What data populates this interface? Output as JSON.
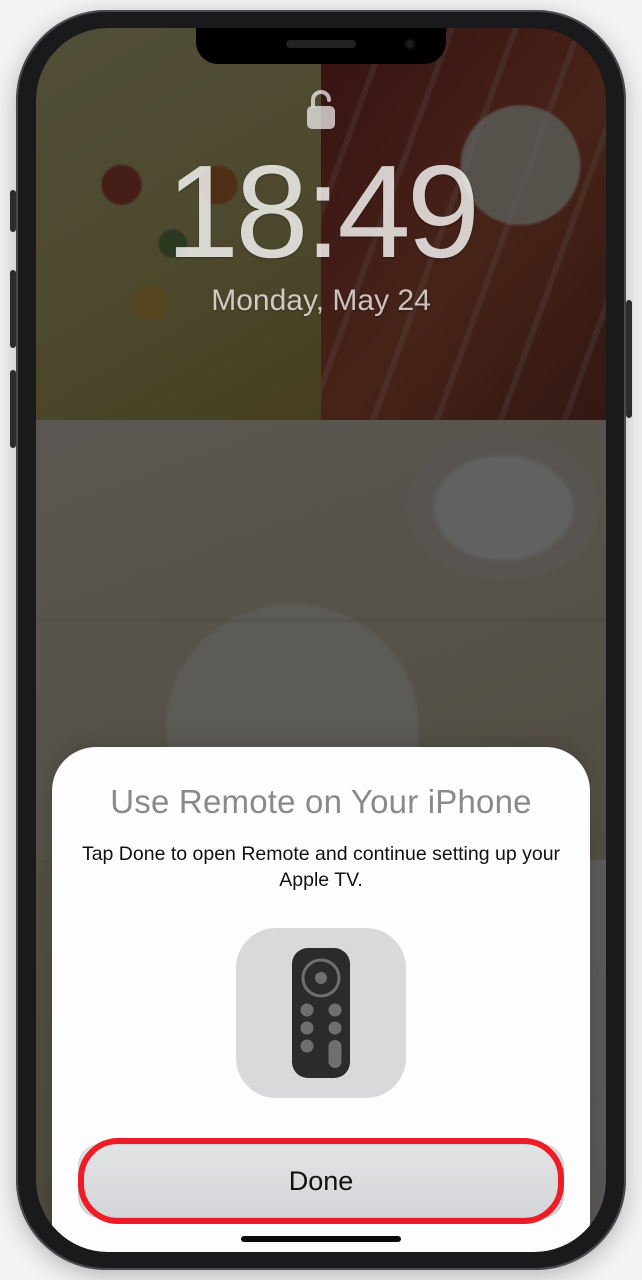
{
  "lock": {
    "time": "18:49",
    "date": "Monday, May 24"
  },
  "sheet": {
    "title": "Use Remote on Your iPhone",
    "body": "Tap Done to open Remote and continue setting up your Apple TV.",
    "done_label": "Done"
  },
  "annotation": {
    "highlight_color": "#ee1c25"
  }
}
